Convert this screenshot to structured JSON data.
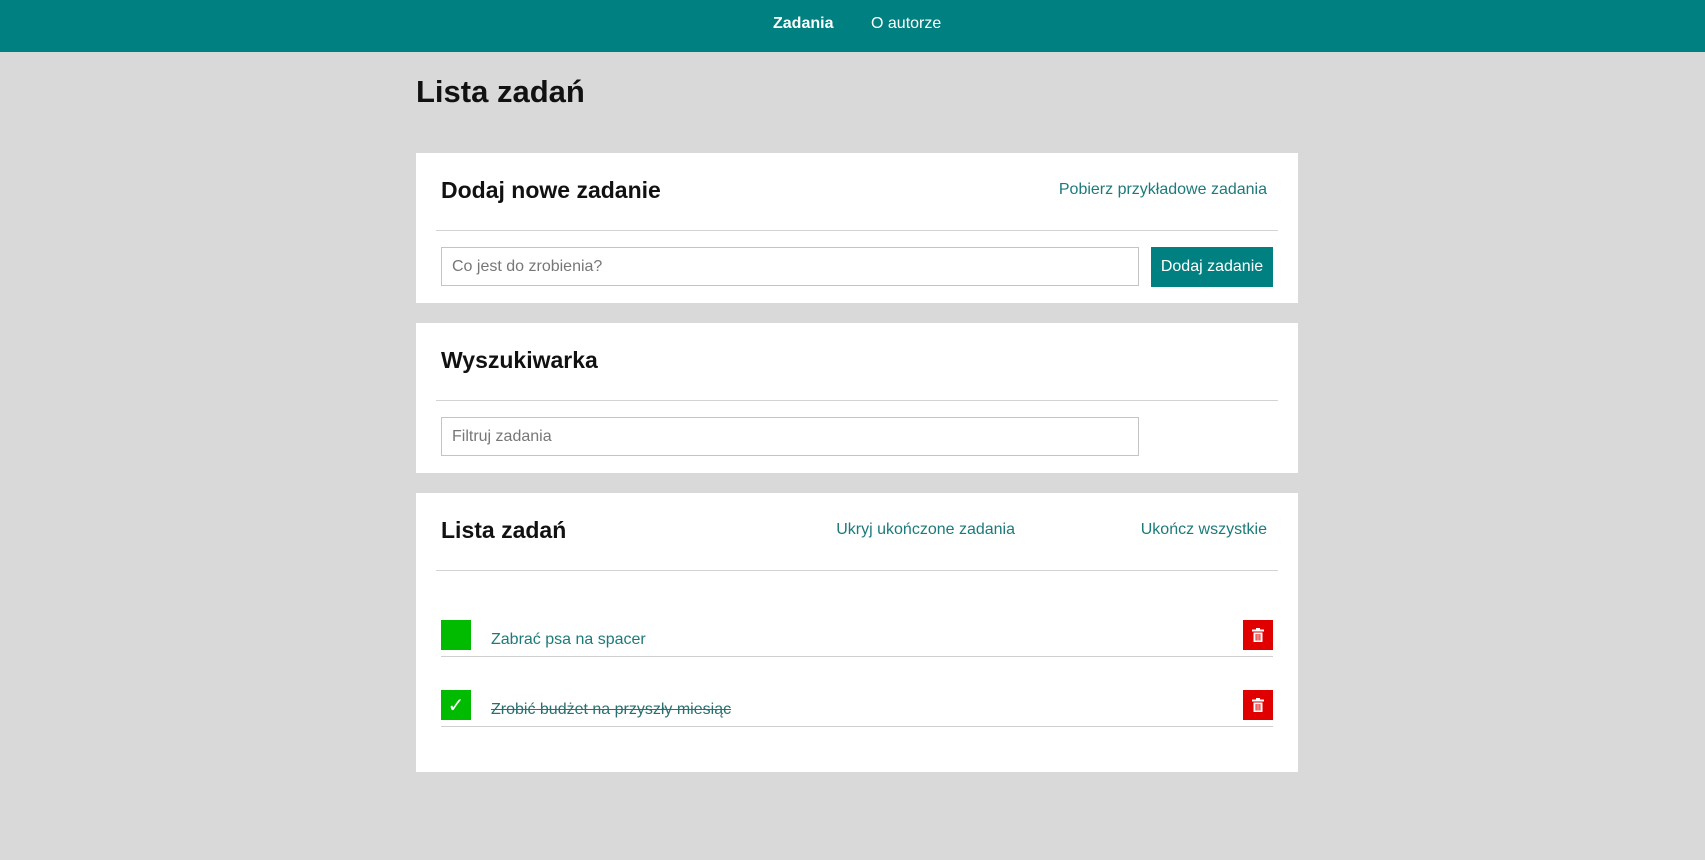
{
  "nav": {
    "items": [
      {
        "label": "Zadania",
        "active": true
      },
      {
        "label": "O autorze",
        "active": false
      }
    ]
  },
  "page": {
    "title": "Lista zadań"
  },
  "add_section": {
    "title": "Dodaj nowe zadanie",
    "sample_link": "Pobierz przykładowe zadania",
    "input_placeholder": "Co jest do zrobienia?",
    "input_value": "",
    "button_label": "Dodaj zadanie"
  },
  "search_section": {
    "title": "Wyszukiwarka",
    "input_placeholder": "Filtruj zadania",
    "input_value": ""
  },
  "list_section": {
    "title": "Lista zadań",
    "hide_completed_link": "Ukryj ukończone zadania",
    "complete_all_link": "Ukończ wszystkie",
    "tasks": [
      {
        "label": "Zabrać psa na spacer",
        "completed": false,
        "check_glyph": ""
      },
      {
        "label": "Zrobić budżet na przyszły miesiąc",
        "completed": true,
        "check_glyph": "✓"
      }
    ]
  },
  "colors": {
    "nav_bg": "#008080",
    "page_bg": "#d9d9d9",
    "accent": "#008080",
    "link": "#1d7a7a",
    "checkbox": "#00bb00",
    "delete": "#e00000"
  },
  "icons": {
    "check": "check-icon",
    "delete": "trash-icon"
  }
}
